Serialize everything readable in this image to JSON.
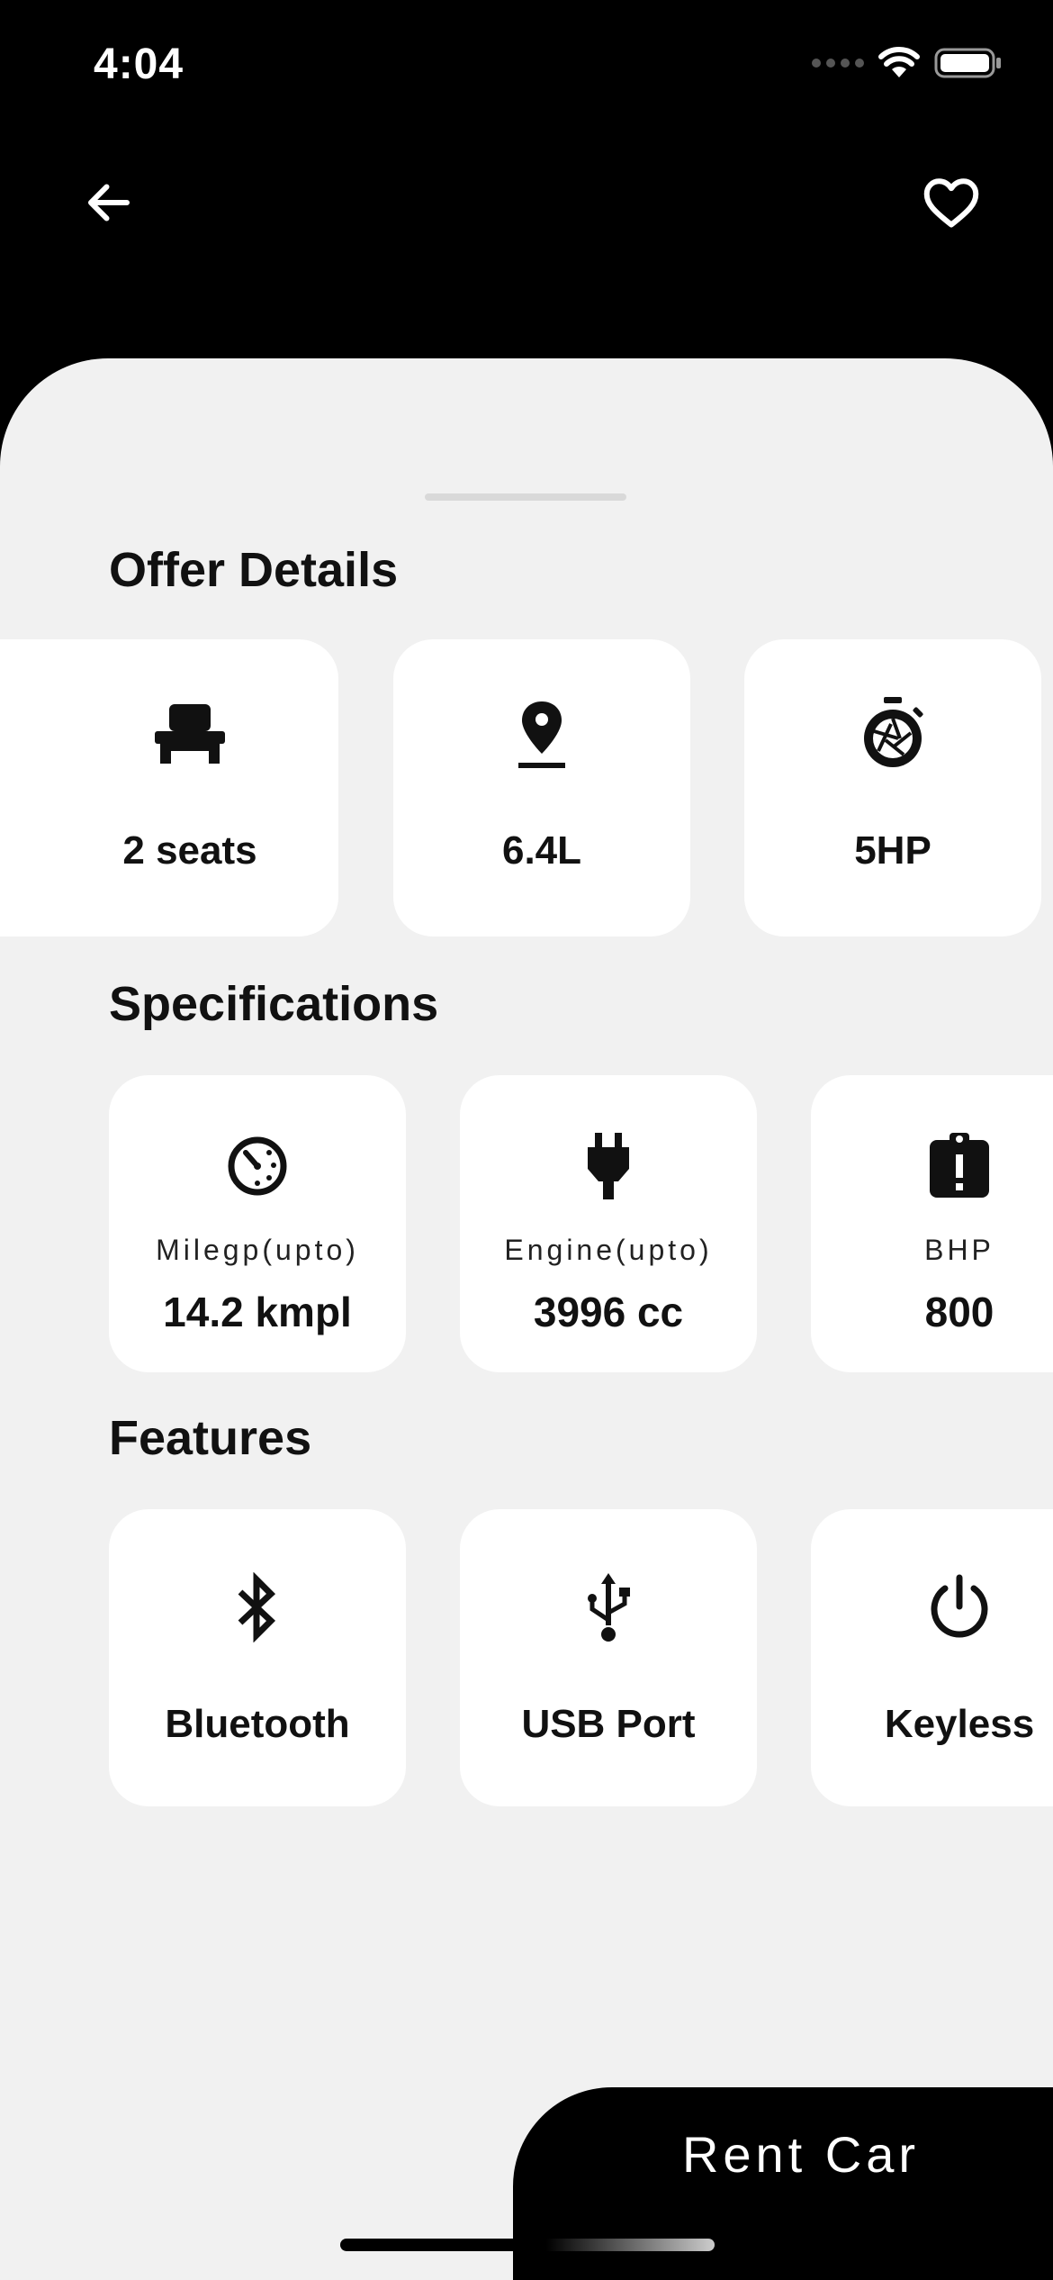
{
  "status": {
    "time": "4:04"
  },
  "sections": {
    "offer_title": "Offer Details",
    "spec_title": "Specifications",
    "features_title": "Features"
  },
  "offer": [
    {
      "icon": "seat-icon",
      "label": "2 seats"
    },
    {
      "icon": "location-pin-icon",
      "label": "6.4L"
    },
    {
      "icon": "stopwatch-icon",
      "label": "5HP"
    }
  ],
  "specs": [
    {
      "icon": "speedometer-icon",
      "label": "Milegp(upto)",
      "value": "14.2 kmpl"
    },
    {
      "icon": "plug-icon",
      "label": "Engine(upto)",
      "value": "3996 cc"
    },
    {
      "icon": "alert-clipboard-icon",
      "label": "BHP",
      "value": "800"
    }
  ],
  "features": [
    {
      "icon": "bluetooth-icon",
      "label": "Bluetooth"
    },
    {
      "icon": "usb-icon",
      "label": "USB Port"
    },
    {
      "icon": "power-icon",
      "label": "Keyless"
    }
  ],
  "cta": {
    "label": "Rent Car"
  },
  "colors": {
    "background": "#000000",
    "sheet": "#f1f1f1",
    "card": "#ffffff",
    "text": "#111111"
  }
}
